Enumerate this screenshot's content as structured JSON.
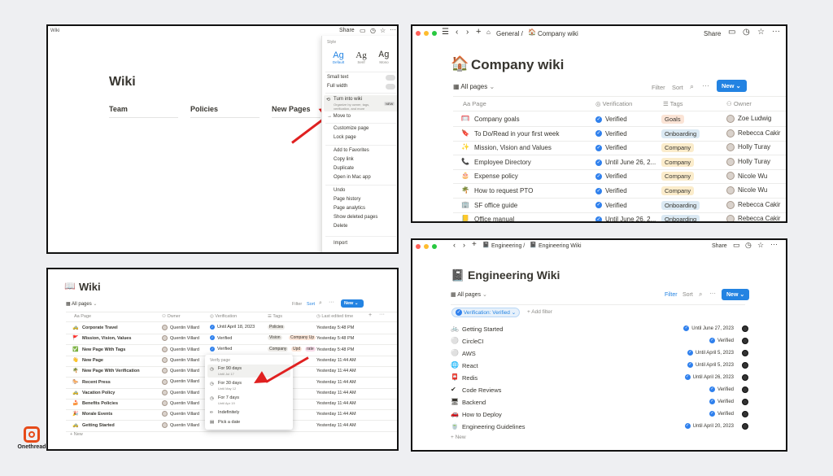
{
  "p1": {
    "title_small": "Wiki",
    "header_share": "Share",
    "title": "Wiki",
    "cols": [
      "Team",
      "Policies",
      "New Pages"
    ],
    "menu": {
      "style_label": "Style",
      "fonts": [
        {
          "glyph": "Ag",
          "label": "Default"
        },
        {
          "glyph": "Ag",
          "label": "Serif"
        },
        {
          "glyph": "Ag",
          "label": "Mono"
        }
      ],
      "small_text": "Small text",
      "full_width": "Full width",
      "turn_into_wiki": "Turn into wiki",
      "turn_into_wiki_sub": "Organize by owner, tags, verification, and more",
      "new_badge": "NEW",
      "move_to": "Move to",
      "items_a": [
        "Customize page",
        "Lock page"
      ],
      "items_b": [
        "Add to Favorites",
        "Copy link",
        "Duplicate",
        "Open in Mac app"
      ],
      "items_c": [
        "Undo",
        "Page history",
        "Page analytics",
        "Show deleted pages",
        "Delete"
      ],
      "import": "Import"
    }
  },
  "p2": {
    "crumbs": "General /",
    "crumb_page": "Company wiki",
    "share": "Share",
    "title": "Company wiki",
    "view": "All pages",
    "filter": "Filter",
    "sort": "Sort",
    "new": "New",
    "headers": [
      "Page",
      "Verification",
      "Tags",
      "Owner"
    ],
    "rows": [
      {
        "icon": "🥅",
        "page": "Company goals",
        "ver": "Verified",
        "tag": "Goals",
        "tag_color": "#fbe4d6",
        "owner": "Zoe Ludwig"
      },
      {
        "icon": "🔖",
        "page": "To Do/Read in your first week",
        "ver": "Verified",
        "tag": "Onboarding",
        "tag_color": "#dbe9f3",
        "owner": "Rebecca Cakir"
      },
      {
        "icon": "✨",
        "page": "Mission, Vision and Values",
        "ver": "Verified",
        "tag": "Company",
        "tag_color": "#fbeccb",
        "owner": "Holly Turay"
      },
      {
        "icon": "📞",
        "page": "Employee Directory",
        "ver": "Until June 26, 2...",
        "tag": "Company",
        "tag_color": "#fbeccb",
        "owner": "Holly Turay"
      },
      {
        "icon": "🎂",
        "page": "Expense policy",
        "ver": "Verified",
        "tag": "Company",
        "tag_color": "#fbeccb",
        "owner": "Nicole Wu"
      },
      {
        "icon": "🌴",
        "page": "How to request PTO",
        "ver": "Verified",
        "tag": "Company",
        "tag_color": "#fbeccb",
        "owner": "Nicole Wu"
      },
      {
        "icon": "🏢",
        "page": "SF office guide",
        "ver": "Verified",
        "tag": "Onboarding",
        "tag_color": "#dbe9f3",
        "owner": "Rebecca Cakir"
      },
      {
        "icon": "📒",
        "page": "Office manual",
        "ver": "Until June 26, 2...",
        "tag": "Onboarding",
        "tag_color": "#dbe9f3",
        "owner": "Rebecca Cakir"
      }
    ]
  },
  "p3": {
    "title": "Wiki",
    "view": "All pages",
    "filter": "Filter",
    "sort": "Sort",
    "new": "New",
    "headers": [
      "Page",
      "Owner",
      "Verification",
      "Tags",
      "Last edited time"
    ],
    "rows": [
      {
        "icon": "🚕",
        "page": "Corporate Travel",
        "owner": "Quentin Villard",
        "ver": "Until April 18, 2023",
        "tags": [
          "Policies"
        ],
        "time": "Yesterday 5:48 PM"
      },
      {
        "icon": "🚩",
        "page": "Mission, Vision, Values",
        "owner": "Quentin Villard",
        "ver": "Verified",
        "tags": [
          "Vision",
          "Company Up"
        ],
        "time": "Yesterday 5:48 PM"
      },
      {
        "icon": "✅",
        "page": "New Page With Tags",
        "owner": "Quentin Villard",
        "ver": "Verified",
        "tags": [
          "Company",
          "Upd",
          "rate"
        ],
        "time": "Yesterday 5:48 PM"
      },
      {
        "icon": "👋",
        "page": "New Page",
        "owner": "Quentin Villard",
        "ver": "",
        "tags": [],
        "time": "Yesterday 11:44 AM"
      },
      {
        "icon": "🌴",
        "page": "New Page With Verification",
        "owner": "Quentin Villard",
        "ver": "",
        "tags": [],
        "time": "Yesterday 11:44 AM"
      },
      {
        "icon": "🐎",
        "page": "Recent Press",
        "owner": "Quentin Villard",
        "ver": "",
        "tags": [
          "Updates"
        ],
        "time": "Yesterday 11:44 AM"
      },
      {
        "icon": "🚕",
        "page": "Vacation Policy",
        "owner": "Quentin Villard",
        "ver": "",
        "tags": [],
        "time": "Yesterday 11:44 AM"
      },
      {
        "icon": "🍰",
        "page": "Benefits Policies",
        "owner": "Quentin Villard",
        "ver": "",
        "tags": [],
        "time": "Yesterday 11:44 AM"
      },
      {
        "icon": "🎉",
        "page": "Morale Events",
        "owner": "Quentin Villard",
        "ver": "",
        "tags": [],
        "time": "Yesterday 11:44 AM"
      },
      {
        "icon": "🚕",
        "page": "Getting Started",
        "owner": "Quentin Villard",
        "ver": "",
        "tags": [],
        "time": "Yesterday 11:44 AM"
      }
    ],
    "new_row": "+ New",
    "popup": {
      "title": "Verify page",
      "options": [
        {
          "label": "For 90 days",
          "sub": "Until Jul 17"
        },
        {
          "label": "For 30 days",
          "sub": "Until May 12"
        },
        {
          "label": "For 7 days",
          "sub": "Until Apr 19"
        },
        {
          "label": "Indefinitely",
          "sub": ""
        },
        {
          "label": "Pick a date",
          "sub": ""
        }
      ]
    }
  },
  "p4": {
    "crumbs": "Engineering /",
    "crumb_page": "Engineering Wiki",
    "share": "Share",
    "title": "Engineering Wiki",
    "view": "All pages",
    "filter": "Filter",
    "sort": "Sort",
    "new": "New",
    "chip": "Verification: Verified",
    "add_filter": "+ Add filter",
    "rows": [
      {
        "icon": "🚲",
        "page": "Getting Started",
        "ver": "Until June 27, 2023"
      },
      {
        "icon": "⚪",
        "page": "CircleCI",
        "ver": "Verified"
      },
      {
        "icon": "⚪",
        "page": "AWS",
        "ver": "Until April 5, 2023"
      },
      {
        "icon": "🌐",
        "page": "React",
        "ver": "Until April 5, 2023"
      },
      {
        "icon": "📮",
        "page": "Redis",
        "ver": "Until April 26, 2023"
      },
      {
        "icon": "✔",
        "page": "Code Reviews",
        "ver": "Verified"
      },
      {
        "icon": "🖥",
        "page": "Backend",
        "ver": "Verified"
      },
      {
        "icon": "🚗",
        "page": "How to Deploy",
        "ver": "Verified"
      },
      {
        "icon": "🍵",
        "page": "Engineering Guidelines",
        "ver": "Until April 20, 2023"
      }
    ],
    "new_row": "+ New"
  },
  "brand": {
    "name": "Onethread"
  }
}
